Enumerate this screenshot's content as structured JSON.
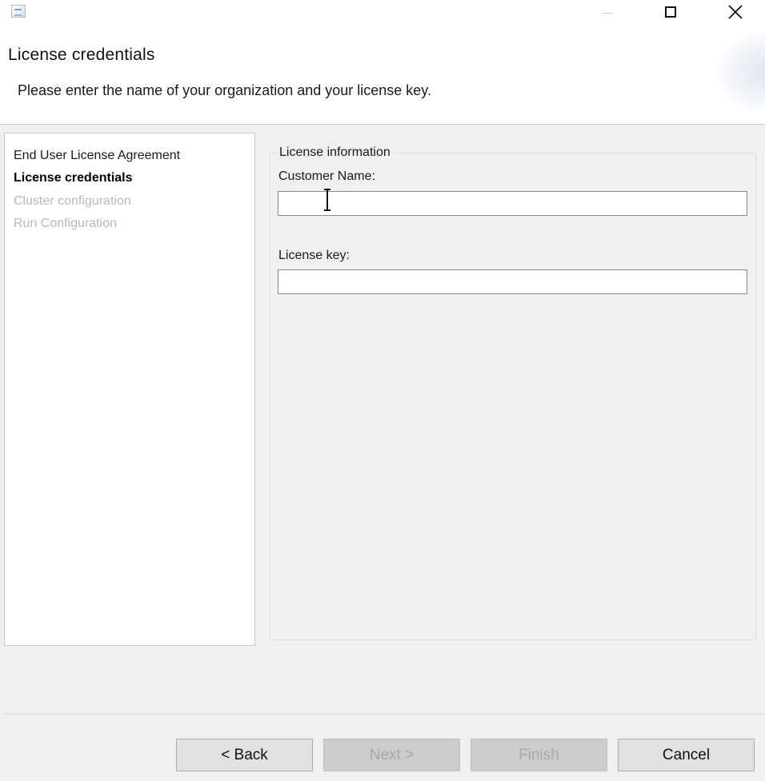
{
  "window": {
    "icon": "app-icon",
    "controls": {
      "minimize_icon": "minimize-icon",
      "maximize_icon": "maximize-icon",
      "close_icon": "close-icon"
    }
  },
  "header": {
    "title": "License credentials",
    "subtitle": "Please enter the name of your organization and your license key."
  },
  "steps": [
    {
      "label": "End User License Agreement",
      "state": "done"
    },
    {
      "label": "License credentials",
      "state": "current"
    },
    {
      "label": "Cluster configuration",
      "state": "pending"
    },
    {
      "label": "Run Configuration",
      "state": "pending"
    }
  ],
  "form": {
    "group_title": "License information",
    "customer_name": {
      "label": "Customer Name:",
      "value": ""
    },
    "license_key": {
      "label": "License key:",
      "value": ""
    }
  },
  "buttons": {
    "back": {
      "label": "< Back",
      "enabled": true
    },
    "next": {
      "label": "Next >",
      "enabled": false
    },
    "finish": {
      "label": "Finish",
      "enabled": false
    },
    "cancel": {
      "label": "Cancel",
      "enabled": true
    }
  },
  "colors": {
    "header_bg": "#ffffff",
    "dialog_bg": "#f0f0f0",
    "disabled_text": "#a8a8a8",
    "pending_step_text": "#b9b9b9"
  }
}
